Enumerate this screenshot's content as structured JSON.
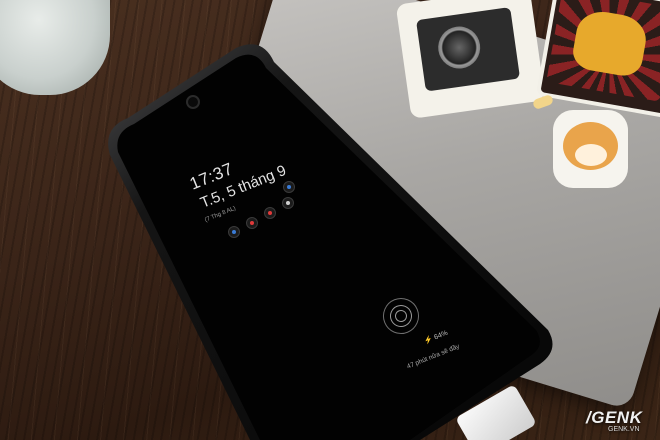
{
  "lock_screen": {
    "time": "17:37",
    "date": "T.5, 5 tháng 9",
    "subtext": "(7 Thg 8 AL)",
    "battery": "64%",
    "charge_remaining": "47 phút nữa sẽ đầy"
  },
  "notification_icons": [
    {
      "color": "#3a7bd5"
    },
    {
      "color": "#e03a3a"
    },
    {
      "color": "#e03a3a"
    },
    {
      "color": "#d0d0d0"
    },
    {
      "color": "#3a7bd5"
    }
  ],
  "watermark": {
    "brand": "GENK",
    "url": "GENK.VN"
  }
}
